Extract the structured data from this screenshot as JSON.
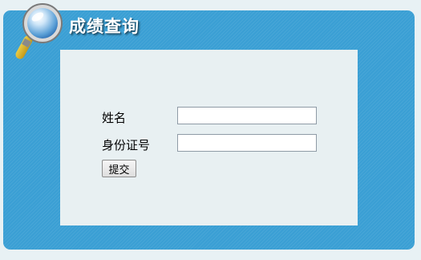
{
  "header": {
    "title": "成绩查询",
    "icon": "magnifier-icon"
  },
  "form": {
    "name_label": "姓名",
    "name_value": "",
    "id_label": "身份证号",
    "id_value": "",
    "submit_label": "提交"
  },
  "colors": {
    "page_background": "#e8f1f4",
    "panel_blue": "#3a9fd4",
    "content_background": "#e8f0f2",
    "magnifier_handle": "#e0b516"
  }
}
